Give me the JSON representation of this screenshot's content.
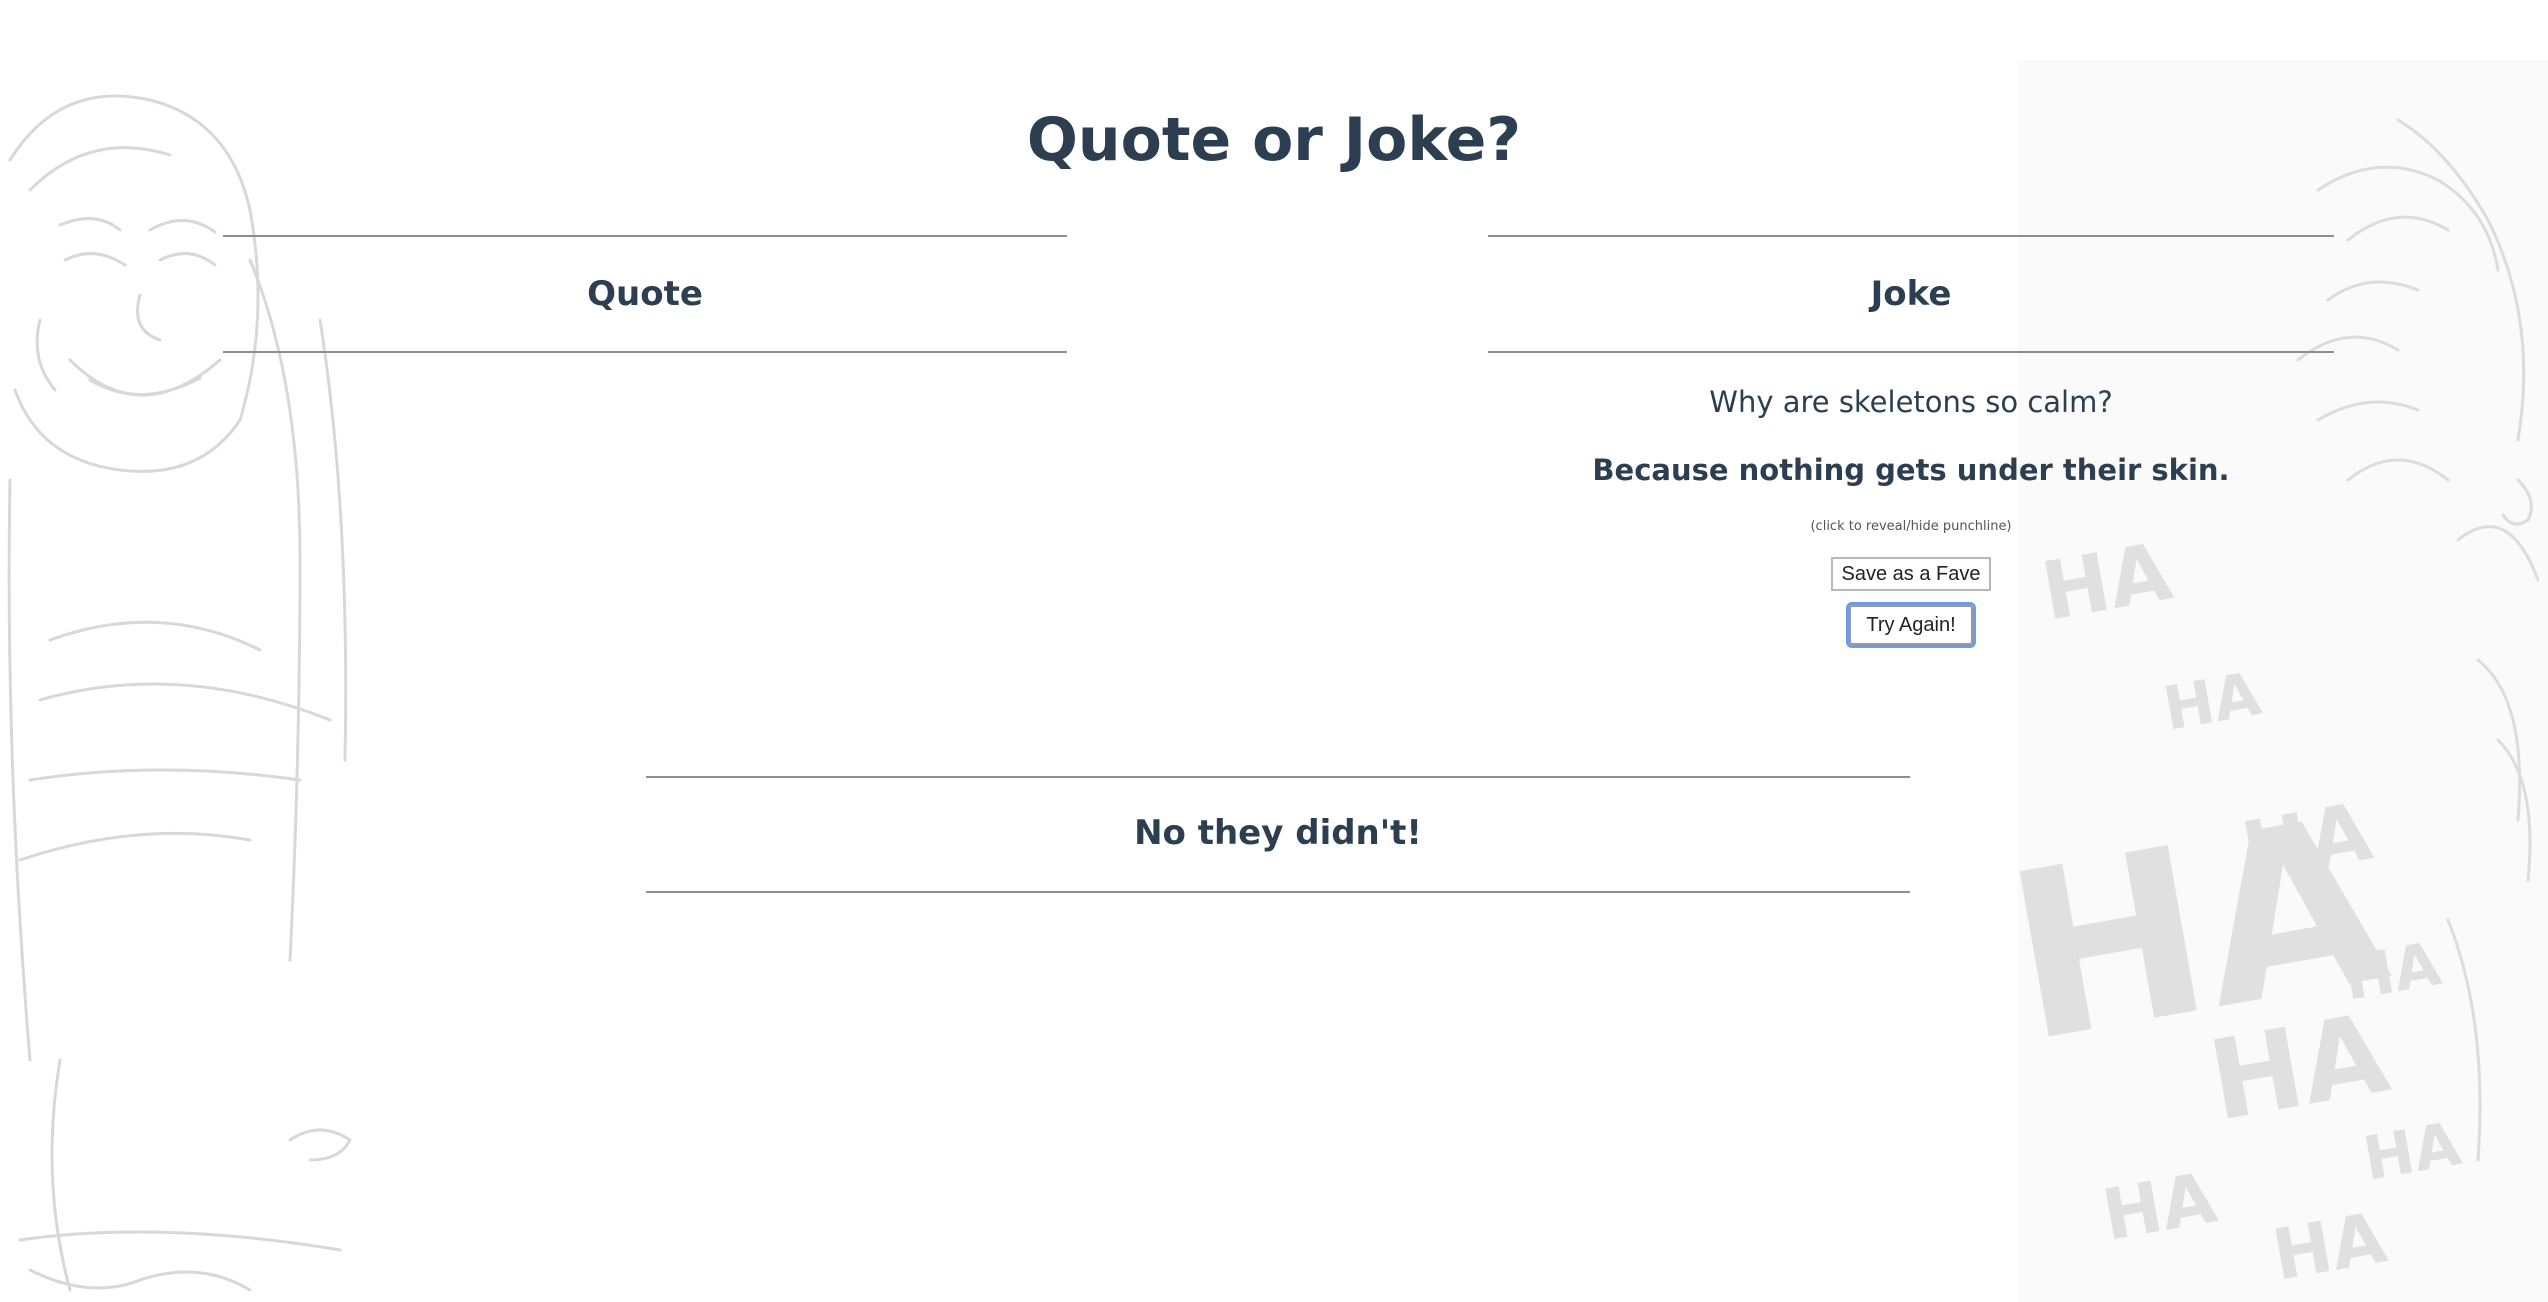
{
  "page": {
    "title": "Quote or Joke?"
  },
  "quote_panel": {
    "heading": "Quote"
  },
  "joke_panel": {
    "heading": "Joke",
    "setup": "Why are skeletons so calm?",
    "punchline": "Because nothing gets under their skin.",
    "hint": "(click to reveal/hide punchline)"
  },
  "buttons": {
    "save_fave": "Save as a Fave",
    "try_again": "Try Again!"
  },
  "result": {
    "text": "No they didn't!"
  },
  "decor": {
    "ha_text": [
      "HA",
      "HA",
      "HA",
      "HA",
      "HA",
      "HA",
      "HA",
      "HA",
      "HA"
    ]
  },
  "colors": {
    "text": "#2c3e50",
    "rule": "#8e8e8e",
    "sketch": "#d9d9d9",
    "focus": "#6c9be8"
  }
}
